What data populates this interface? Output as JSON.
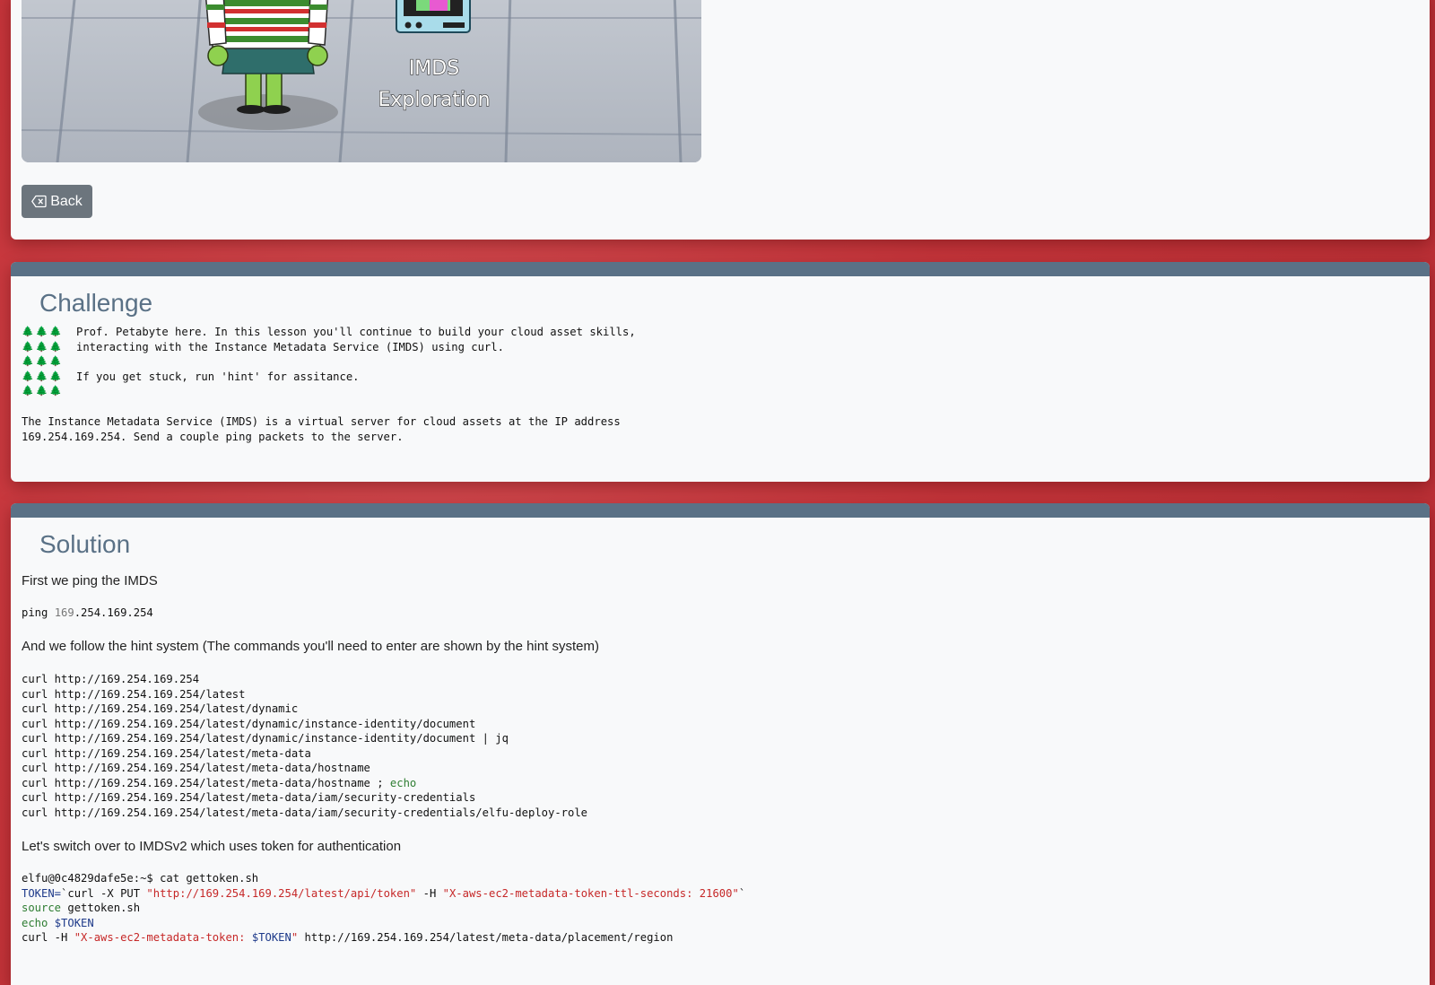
{
  "top_card": {
    "image_caption_line1": "IMDS",
    "image_caption_line2": "Exploration",
    "back_label": "Back"
  },
  "challenge": {
    "title": "Challenge",
    "tree_rows": [
      "🌲🌲🌲",
      "🌲🌲🌲",
      "🌲🌲🌲",
      "🌲🌲🌲",
      "🌲🌲🌲"
    ],
    "message_lines": [
      "Prof. Petabyte here. In this lesson you'll continue to build your cloud asset skills,",
      "interacting with the Instance Metadata Service (IMDS) using curl.",
      "",
      "If you get stuck, run 'hint' for assitance.",
      ""
    ],
    "body_line1": "The Instance Metadata Service (IMDS) is a virtual server for cloud assets at the IP address",
    "body_line2": "169.254.169.254. Send a couple ping packets to the server."
  },
  "solution": {
    "title": "Solution",
    "intro": "First we ping the IMDS",
    "ping_cmd_prefix": "ping ",
    "ping_cmd_num": "169",
    "ping_cmd_rest": ".254.169.254",
    "hint_text": "And we follow the hint system (The commands you'll need to enter are shown by the hint system)",
    "curl_commands": [
      "curl http://169.254.169.254",
      "curl http://169.254.169.254/latest",
      "curl http://169.254.169.254/latest/dynamic",
      "curl http://169.254.169.254/latest/dynamic/instance-identity/document",
      "curl http://169.254.169.254/latest/dynamic/instance-identity/document | jq",
      "curl http://169.254.169.254/latest/meta-data",
      "curl http://169.254.169.254/latest/meta-data/hostname",
      "curl http://169.254.169.254/latest/meta-data/hostname ; ",
      "curl http://169.254.169.254/latest/meta-data/iam/security-credentials",
      "curl http://169.254.169.254/latest/meta-data/iam/security-credentials/elfu-deploy-role"
    ],
    "echo_word": "echo",
    "imdsv2_text": "Let's switch over to IMDSv2 which uses token for authentication",
    "v2": {
      "prompt_line": "elfu@0c4829dafe5e:~$ cat gettoken.sh",
      "token_var": "TOKEN=",
      "token_cmd": "`curl -X PUT ",
      "token_url": "\"http://169.254.169.254/latest/api/token\"",
      "token_h": " -H ",
      "token_header": "\"X-aws-ec2-metadata-token-ttl-seconds: 21600\"",
      "token_end": "`",
      "source_kw": "source",
      "source_rest": " gettoken.sh",
      "echo_kw": "echo",
      "echo_var": " $TOKEN",
      "curl_prefix": "curl -H ",
      "curl_header_a": "\"X-aws-ec2-metadata-token: ",
      "curl_header_var": "$TOKEN",
      "curl_header_b": "\"",
      "curl_url": " http://169.254.169.254/latest/meta-data/placement/region"
    }
  },
  "colors": {
    "background": "#c8343a",
    "card": "#f8f9fa",
    "header_bar": "#5a7186",
    "button": "#6c757d"
  }
}
